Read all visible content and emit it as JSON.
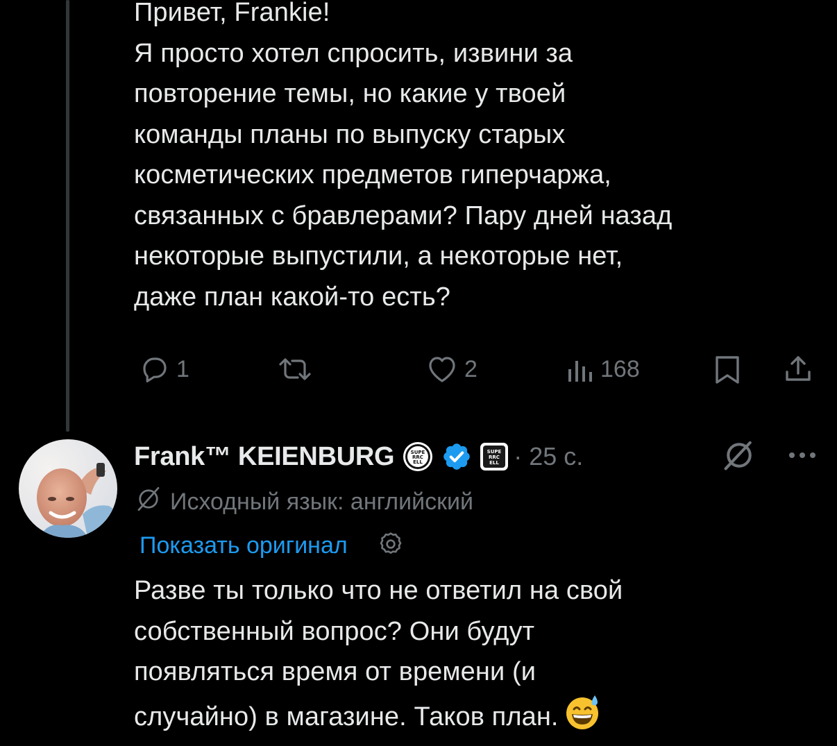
{
  "parent_tweet": {
    "lines": [
      "Привет, Frankie!",
      "Я просто хотел спросить, извини за",
      "повторение темы, но какие у твоей",
      "команды планы по выпуску старых",
      "косметических предметов гиперчаржа,",
      "связанных с бравлерами? Пару дней назад",
      "некоторые выпустили, а некоторые нет,",
      "даже план какой-то есть?"
    ],
    "actions": {
      "reply_count": "1",
      "repost_count": "",
      "like_count": "2",
      "views_count": "168"
    }
  },
  "reply_tweet": {
    "author_name": "Frank™ KEIENBURG",
    "time": "· 25 с.",
    "translation_notice": "Исходный язык: английский",
    "show_original_label": "Показать оригинал",
    "lines": [
      "Разве ты только что не ответил на свой",
      "собственный вопрос? Они будут",
      "появляться время от времени (и",
      "случайно) в магазине. Таков план."
    ],
    "emoji": "😅",
    "badges": [
      "supercell-round-badge",
      "verified-badge",
      "supercell-square-badge"
    ],
    "badge_text": "SUPERCELL"
  },
  "colors": {
    "background": "#000000",
    "text_primary": "#e7e9ea",
    "text_secondary": "#71767b",
    "link": "#1d9bf0",
    "verified": "#1d9bf0",
    "thread_line": "#333639"
  },
  "icons": {
    "reply": "reply-icon",
    "repost": "repost-icon",
    "like": "heart-icon",
    "views": "views-icon",
    "bookmark": "bookmark-icon",
    "share": "share-icon",
    "translate": "translate-icon",
    "more": "more-icon",
    "settings": "gear-icon"
  }
}
